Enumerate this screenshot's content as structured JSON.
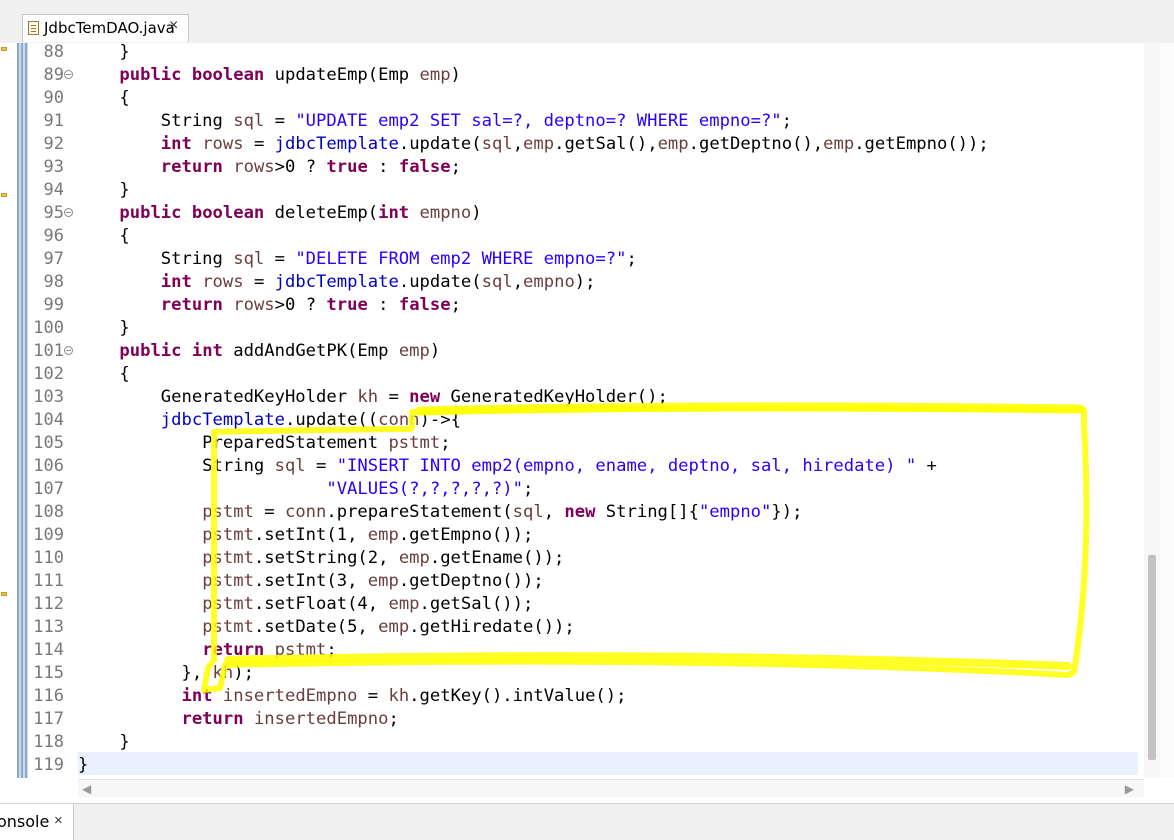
{
  "editor_tab": {
    "file_icon": "java-file-icon",
    "title": "JdbcTemDAO.java",
    "close": "×"
  },
  "fold_marker": "⊖",
  "lines": [
    {
      "n": "88",
      "fold": false,
      "tokens": [
        [
          "t",
          "    }"
        ]
      ]
    },
    {
      "n": "89",
      "fold": true,
      "tokens": [
        [
          "t",
          "    "
        ],
        [
          "kw",
          "public boolean"
        ],
        [
          "t",
          " updateEmp(Emp "
        ],
        [
          "var",
          "emp"
        ],
        [
          "t",
          ")"
        ]
      ]
    },
    {
      "n": "90",
      "fold": false,
      "tokens": [
        [
          "t",
          "    {"
        ]
      ]
    },
    {
      "n": "91",
      "fold": false,
      "tokens": [
        [
          "t",
          "        String "
        ],
        [
          "var",
          "sql"
        ],
        [
          "t",
          " = "
        ],
        [
          "str",
          "\"UPDATE emp2 SET sal=?, deptno=? WHERE empno=?\""
        ],
        [
          "t",
          ";"
        ]
      ]
    },
    {
      "n": "92",
      "fold": false,
      "tokens": [
        [
          "t",
          "        "
        ],
        [
          "kw",
          "int"
        ],
        [
          "t",
          " "
        ],
        [
          "var",
          "rows"
        ],
        [
          "t",
          " = "
        ],
        [
          "fld",
          "jdbcTemplate"
        ],
        [
          "t",
          ".update("
        ],
        [
          "var",
          "sql"
        ],
        [
          "t",
          ","
        ],
        [
          "var",
          "emp"
        ],
        [
          "t",
          ".getSal(),"
        ],
        [
          "var",
          "emp"
        ],
        [
          "t",
          ".getDeptno(),"
        ],
        [
          "var",
          "emp"
        ],
        [
          "t",
          ".getEmpno());"
        ]
      ]
    },
    {
      "n": "93",
      "fold": false,
      "tokens": [
        [
          "t",
          "        "
        ],
        [
          "kw",
          "return"
        ],
        [
          "t",
          " "
        ],
        [
          "var",
          "rows"
        ],
        [
          "t",
          ">0 ? "
        ],
        [
          "kw",
          "true"
        ],
        [
          "t",
          " : "
        ],
        [
          "kw",
          "false"
        ],
        [
          "t",
          ";"
        ]
      ]
    },
    {
      "n": "94",
      "fold": false,
      "tokens": [
        [
          "t",
          "    }"
        ]
      ]
    },
    {
      "n": "95",
      "fold": true,
      "tokens": [
        [
          "t",
          "    "
        ],
        [
          "kw",
          "public boolean"
        ],
        [
          "t",
          " deleteEmp("
        ],
        [
          "kw",
          "int"
        ],
        [
          "t",
          " "
        ],
        [
          "var",
          "empno"
        ],
        [
          "t",
          ")"
        ]
      ]
    },
    {
      "n": "96",
      "fold": false,
      "tokens": [
        [
          "t",
          "    {"
        ]
      ]
    },
    {
      "n": "97",
      "fold": false,
      "tokens": [
        [
          "t",
          "        String "
        ],
        [
          "var",
          "sql"
        ],
        [
          "t",
          " = "
        ],
        [
          "str",
          "\"DELETE FROM emp2 WHERE empno=?\""
        ],
        [
          "t",
          ";"
        ]
      ]
    },
    {
      "n": "98",
      "fold": false,
      "tokens": [
        [
          "t",
          "        "
        ],
        [
          "kw",
          "int"
        ],
        [
          "t",
          " "
        ],
        [
          "var",
          "rows"
        ],
        [
          "t",
          " = "
        ],
        [
          "fld",
          "jdbcTemplate"
        ],
        [
          "t",
          ".update("
        ],
        [
          "var",
          "sql"
        ],
        [
          "t",
          ","
        ],
        [
          "var",
          "empno"
        ],
        [
          "t",
          ");"
        ]
      ]
    },
    {
      "n": "99",
      "fold": false,
      "tokens": [
        [
          "t",
          "        "
        ],
        [
          "kw",
          "return"
        ],
        [
          "t",
          " "
        ],
        [
          "var",
          "rows"
        ],
        [
          "t",
          ">0 ? "
        ],
        [
          "kw",
          "true"
        ],
        [
          "t",
          " : "
        ],
        [
          "kw",
          "false"
        ],
        [
          "t",
          ";"
        ]
      ]
    },
    {
      "n": "100",
      "fold": false,
      "tokens": [
        [
          "t",
          "    }"
        ]
      ]
    },
    {
      "n": "101",
      "fold": true,
      "tokens": [
        [
          "t",
          "    "
        ],
        [
          "kw",
          "public int"
        ],
        [
          "t",
          " addAndGetPK(Emp "
        ],
        [
          "var",
          "emp"
        ],
        [
          "t",
          ")"
        ]
      ]
    },
    {
      "n": "102",
      "fold": false,
      "tokens": [
        [
          "t",
          "    {"
        ]
      ]
    },
    {
      "n": "103",
      "fold": false,
      "tokens": [
        [
          "t",
          "        GeneratedKeyHolder "
        ],
        [
          "var",
          "kh"
        ],
        [
          "t",
          " = "
        ],
        [
          "kw",
          "new"
        ],
        [
          "t",
          " GeneratedKeyHolder();"
        ]
      ]
    },
    {
      "n": "104",
      "fold": false,
      "tokens": [
        [
          "t",
          "        "
        ],
        [
          "fld",
          "jdbcTemplate"
        ],
        [
          "t",
          ".update(("
        ],
        [
          "var",
          "conn"
        ],
        [
          "t",
          ")->{"
        ]
      ]
    },
    {
      "n": "105",
      "fold": false,
      "tokens": [
        [
          "t",
          "            PreparedStatement "
        ],
        [
          "var",
          "pstmt"
        ],
        [
          "t",
          ";"
        ]
      ]
    },
    {
      "n": "106",
      "fold": false,
      "tokens": [
        [
          "t",
          "            String "
        ],
        [
          "var",
          "sql"
        ],
        [
          "t",
          " = "
        ],
        [
          "str",
          "\"INSERT INTO emp2(empno, ename, deptno, sal, hiredate) \""
        ],
        [
          "t",
          " +"
        ]
      ]
    },
    {
      "n": "107",
      "fold": false,
      "tokens": [
        [
          "t",
          "                        "
        ],
        [
          "str",
          "\"VALUES(?,?,?,?,?)\""
        ],
        [
          "t",
          ";"
        ]
      ]
    },
    {
      "n": "108",
      "fold": false,
      "tokens": [
        [
          "t",
          "            "
        ],
        [
          "var",
          "pstmt"
        ],
        [
          "t",
          " = "
        ],
        [
          "var",
          "conn"
        ],
        [
          "t",
          ".prepareStatement("
        ],
        [
          "var",
          "sql"
        ],
        [
          "t",
          ", "
        ],
        [
          "kw",
          "new"
        ],
        [
          "t",
          " String[]{"
        ],
        [
          "str",
          "\"empno\""
        ],
        [
          "t",
          "});"
        ]
      ]
    },
    {
      "n": "109",
      "fold": false,
      "tokens": [
        [
          "t",
          "            "
        ],
        [
          "var",
          "pstmt"
        ],
        [
          "t",
          ".setInt(1, "
        ],
        [
          "var",
          "emp"
        ],
        [
          "t",
          ".getEmpno());"
        ]
      ]
    },
    {
      "n": "110",
      "fold": false,
      "tokens": [
        [
          "t",
          "            "
        ],
        [
          "var",
          "pstmt"
        ],
        [
          "t",
          ".setString(2, "
        ],
        [
          "var",
          "emp"
        ],
        [
          "t",
          ".getEname());"
        ]
      ]
    },
    {
      "n": "111",
      "fold": false,
      "tokens": [
        [
          "t",
          "            "
        ],
        [
          "var",
          "pstmt"
        ],
        [
          "t",
          ".setInt(3, "
        ],
        [
          "var",
          "emp"
        ],
        [
          "t",
          ".getDeptno());"
        ]
      ]
    },
    {
      "n": "112",
      "fold": false,
      "tokens": [
        [
          "t",
          "            "
        ],
        [
          "var",
          "pstmt"
        ],
        [
          "t",
          ".setFloat(4, "
        ],
        [
          "var",
          "emp"
        ],
        [
          "t",
          ".getSal());"
        ]
      ]
    },
    {
      "n": "113",
      "fold": false,
      "tokens": [
        [
          "t",
          "            "
        ],
        [
          "var",
          "pstmt"
        ],
        [
          "t",
          ".setDate(5, "
        ],
        [
          "var",
          "emp"
        ],
        [
          "t",
          ".getHiredate());"
        ]
      ]
    },
    {
      "n": "114",
      "fold": false,
      "tokens": [
        [
          "t",
          "            "
        ],
        [
          "kw",
          "return"
        ],
        [
          "t",
          " "
        ],
        [
          "var",
          "pstmt"
        ],
        [
          "t",
          ";"
        ]
      ]
    },
    {
      "n": "115",
      "fold": false,
      "tokens": [
        [
          "t",
          "          }, "
        ],
        [
          "var",
          "kh"
        ],
        [
          "t",
          ");"
        ]
      ]
    },
    {
      "n": "116",
      "fold": false,
      "tokens": [
        [
          "t",
          "          "
        ],
        [
          "kw",
          "int"
        ],
        [
          "t",
          " "
        ],
        [
          "var",
          "insertedEmpno"
        ],
        [
          "t",
          " = "
        ],
        [
          "var",
          "kh"
        ],
        [
          "t",
          ".getKey().intValue();"
        ]
      ]
    },
    {
      "n": "117",
      "fold": false,
      "tokens": [
        [
          "t",
          "          "
        ],
        [
          "kw",
          "return"
        ],
        [
          "t",
          " "
        ],
        [
          "var",
          "insertedEmpno"
        ],
        [
          "t",
          ";"
        ]
      ]
    },
    {
      "n": "118",
      "fold": false,
      "tokens": [
        [
          "t",
          "    }"
        ]
      ]
    },
    {
      "n": "119",
      "fold": false,
      "tokens": [
        [
          "t",
          "}"
        ]
      ]
    }
  ],
  "console_tab": {
    "label": "onsole",
    "close": "×"
  },
  "colors": {
    "keyword": "#7f0055",
    "string": "#2a00ff",
    "local_var": "#6a3e3e",
    "field": "#0000c0",
    "highlight": "#ffff00"
  }
}
